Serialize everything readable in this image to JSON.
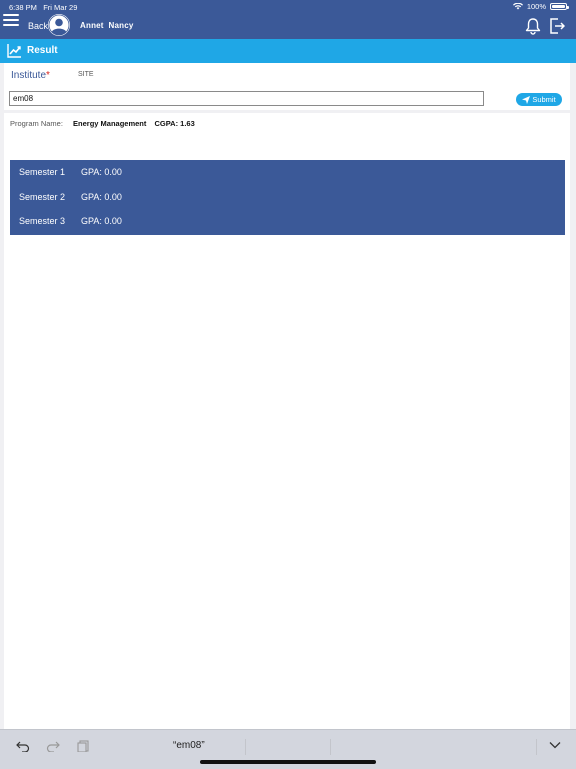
{
  "status": {
    "time": "6:38 PM",
    "date": "Fri Mar 29",
    "battery": "100%"
  },
  "nav": {
    "back_label": "Back",
    "user_first": "Annet",
    "user_last": "Nancy"
  },
  "result_bar": {
    "title": "Result"
  },
  "form": {
    "institute_label": "Institute",
    "required_mark": "*",
    "institute_value": "SITE",
    "search_value": "em08",
    "submit_label": "Submit"
  },
  "program": {
    "label": "Program Name:",
    "name": "Energy Management",
    "cgpa": "CGPA: 1.63"
  },
  "semesters": [
    {
      "name": "Semester 1",
      "gpa": "GPA: 0.00"
    },
    {
      "name": "Semester 2",
      "gpa": "GPA: 0.00"
    },
    {
      "name": "Semester 3",
      "gpa": "GPA: 0.00"
    }
  ],
  "keyboard": {
    "suggestion": "“em08”"
  },
  "colors": {
    "nav_bg": "#3b5998",
    "accent": "#1fa7e6",
    "required": "#d9251d"
  }
}
